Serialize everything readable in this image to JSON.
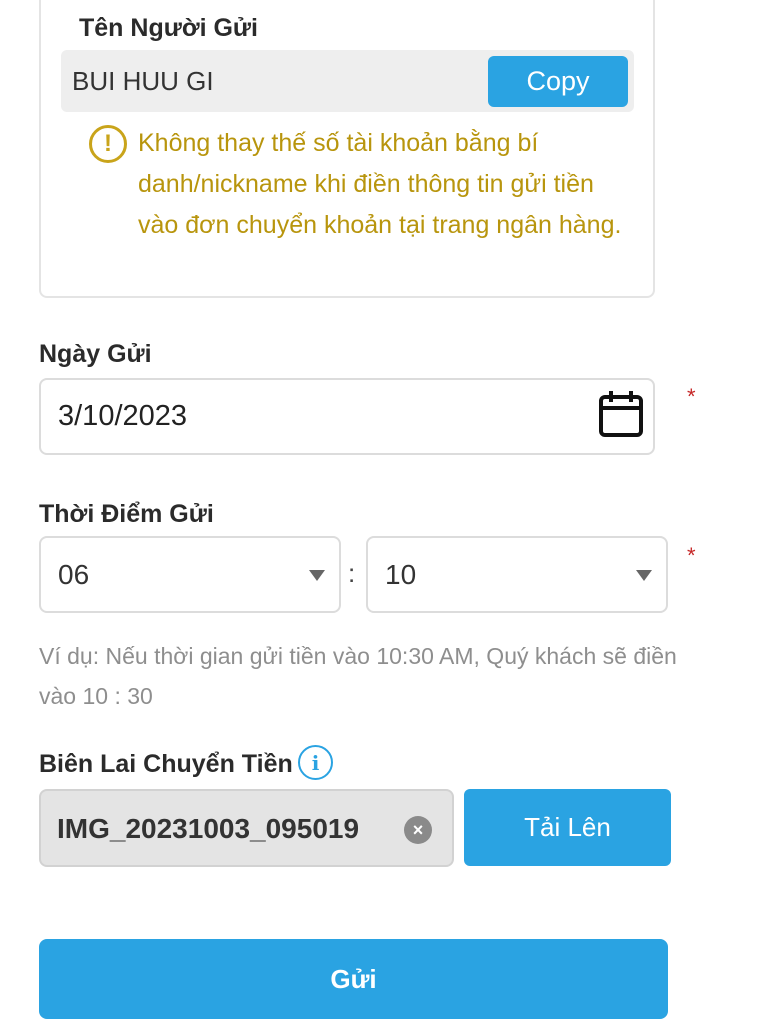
{
  "sender": {
    "label": "Tên Người Gửi",
    "name": "BUI HUU GI",
    "copy_label": "Copy",
    "warning": "Không thay thế số tài khoản bằng bí danh/nickname khi điền thông tin gửi tiền vào đơn chuyển khoản tại trang ngân hàng.",
    "warning_icon": "!"
  },
  "date": {
    "label": "Ngày Gửi",
    "value": "3/10/2023",
    "required_mark": "*"
  },
  "time": {
    "label": "Thời Điểm Gửi",
    "hour": "06",
    "minute": "10",
    "separator": ":",
    "required_mark": "*",
    "hint": "Ví dụ: Nếu thời gian gửi tiền vào 10:30 AM, Quý khách sẽ điền vào 10 : 30"
  },
  "receipt": {
    "label": "Biên Lai Chuyển Tiền",
    "info_icon": "i",
    "file_name": "IMG_20231003_095019",
    "clear_icon": "×",
    "upload_label": "Tải Lên"
  },
  "submit_label": "Gửi",
  "colors": {
    "accent": "#2aa3e2",
    "warning": "#b8950d",
    "required": "#c62828",
    "hint": "#8e8e8e"
  }
}
